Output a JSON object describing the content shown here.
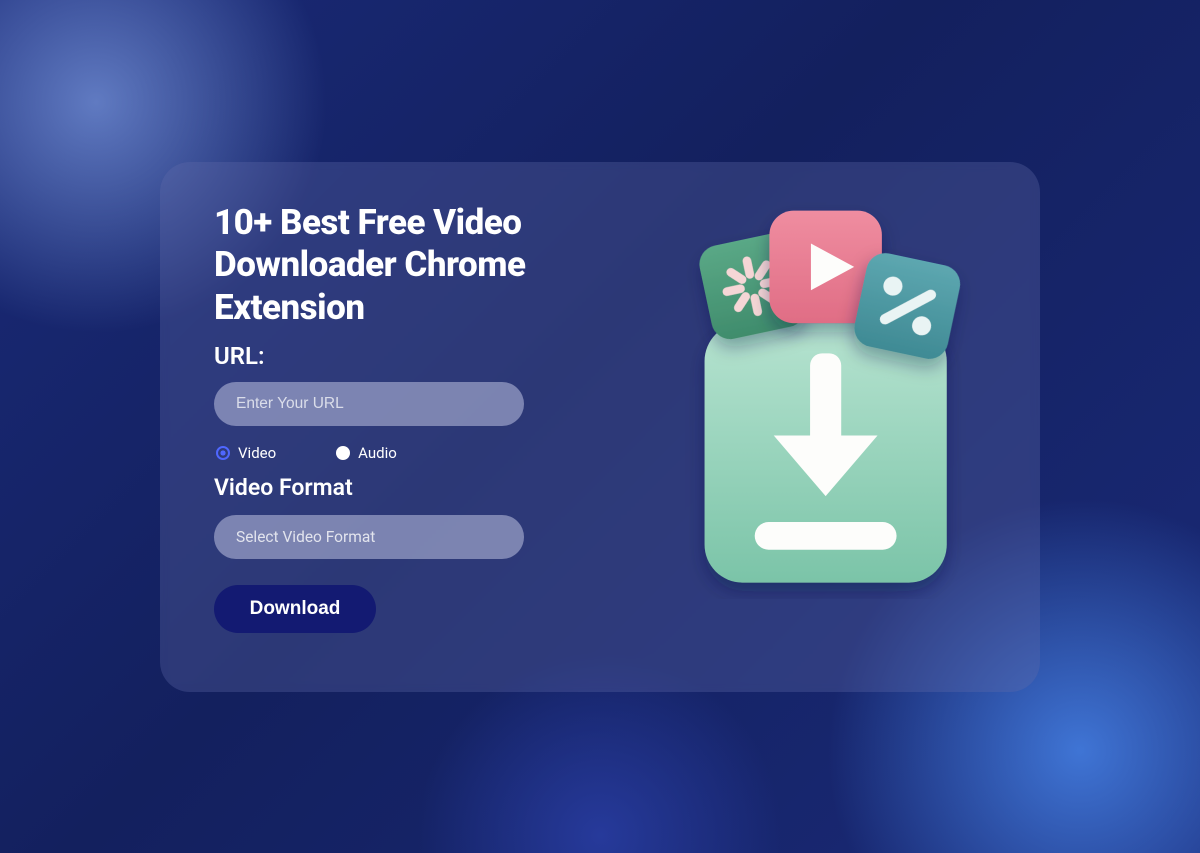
{
  "card": {
    "title": "10+ Best Free Video Downloader Chrome Extension",
    "url_label": "URL:",
    "url_placeholder": "Enter Your URL",
    "radios": [
      {
        "label": "Video",
        "selected": true
      },
      {
        "label": "Audio",
        "selected": false
      }
    ],
    "format_label": "Video Format",
    "format_placeholder": "Select Video Format",
    "download_label": "Download"
  }
}
